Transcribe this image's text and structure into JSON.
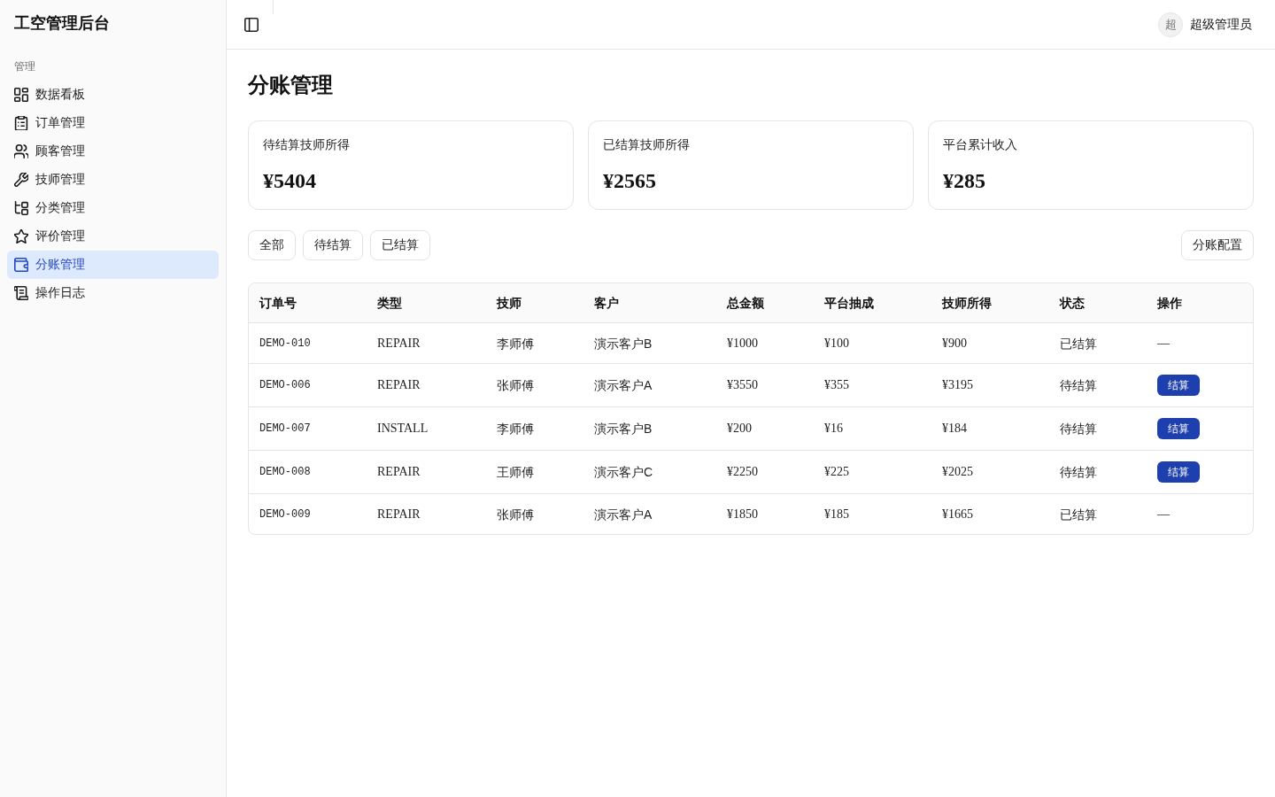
{
  "sidebar": {
    "title": "工空管理后台",
    "section": "管理",
    "items": [
      {
        "label": "数据看板",
        "selected": false
      },
      {
        "label": "订单管理",
        "selected": false
      },
      {
        "label": "顾客管理",
        "selected": false
      },
      {
        "label": "技师管理",
        "selected": false
      },
      {
        "label": "分类管理",
        "selected": false
      },
      {
        "label": "评价管理",
        "selected": false
      },
      {
        "label": "分账管理",
        "selected": true
      },
      {
        "label": "操作日志",
        "selected": false
      }
    ]
  },
  "header": {
    "avatar": "超",
    "user": "超级管理员"
  },
  "page": {
    "title": "分账管理"
  },
  "stats": [
    {
      "label": "待结算技师所得",
      "value": "¥5404"
    },
    {
      "label": "已结算技师所得",
      "value": "¥2565"
    },
    {
      "label": "平台累计收入",
      "value": "¥285"
    }
  ],
  "filters": [
    {
      "label": "全部",
      "selected": false
    },
    {
      "label": "待结算",
      "selected": false
    },
    {
      "label": "已结算",
      "selected": false
    }
  ],
  "config_button": "分账配置",
  "table": {
    "columns": [
      "订单号",
      "类型",
      "技师",
      "客户",
      "总金额",
      "平台抽成",
      "技师所得",
      "状态",
      "操作"
    ],
    "rows": [
      {
        "order_id": "DEMO-010",
        "type": "REPAIR",
        "technician": "李师傅",
        "customer": "演示客户B",
        "total": "¥1000",
        "commission": "¥100",
        "earnings": "¥900",
        "status": "已结算",
        "action": {
          "kind": "text",
          "label": "—"
        }
      },
      {
        "order_id": "DEMO-006",
        "type": "REPAIR",
        "technician": "张师傅",
        "customer": "演示客户A",
        "total": "¥3550",
        "commission": "¥355",
        "earnings": "¥3195",
        "status": "待结算",
        "action": {
          "kind": "button",
          "label": "结算"
        }
      },
      {
        "order_id": "DEMO-007",
        "type": "INSTALL",
        "technician": "李师傅",
        "customer": "演示客户B",
        "total": "¥200",
        "commission": "¥16",
        "earnings": "¥184",
        "status": "待结算",
        "action": {
          "kind": "button",
          "label": "结算"
        }
      },
      {
        "order_id": "DEMO-008",
        "type": "REPAIR",
        "technician": "王师傅",
        "customer": "演示客户C",
        "total": "¥2250",
        "commission": "¥225",
        "earnings": "¥2025",
        "status": "待结算",
        "action": {
          "kind": "button",
          "label": "结算"
        }
      },
      {
        "order_id": "DEMO-009",
        "type": "REPAIR",
        "technician": "张师傅",
        "customer": "演示客户A",
        "total": "¥1850",
        "commission": "¥185",
        "earnings": "¥1665",
        "status": "已结算",
        "action": {
          "kind": "text",
          "label": "—"
        }
      }
    ]
  }
}
